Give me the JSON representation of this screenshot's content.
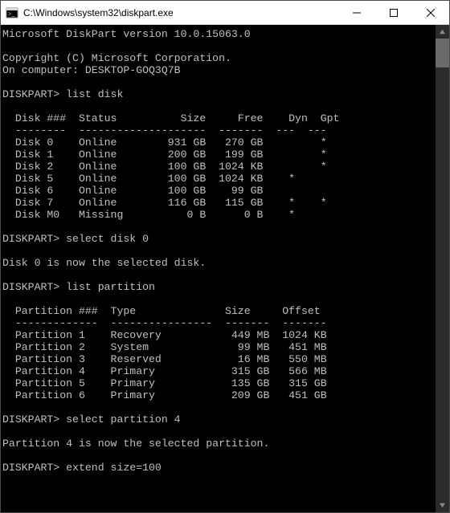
{
  "window": {
    "title": "C:\\Windows\\system32\\diskpart.exe"
  },
  "banner": {
    "version_line": "Microsoft DiskPart version 10.0.15063.0",
    "copyright": "Copyright (C) Microsoft Corporation.",
    "computer": "On computer: DESKTOP-GOQ3Q7B"
  },
  "prompt": "DISKPART>",
  "commands": {
    "list_disk": "list disk",
    "select_disk0": "select disk 0",
    "list_partition": "list partition",
    "select_part4": "select partition 4",
    "extend100": "extend size=100"
  },
  "messages": {
    "disk0_selected": "Disk 0 is now the selected disk.",
    "part4_selected": "Partition 4 is now the selected partition."
  },
  "disk_headers": {
    "disk": "Disk ###",
    "status": "Status",
    "size": "Size",
    "free": "Free",
    "dyn": "Dyn",
    "gpt": "Gpt"
  },
  "disks": [
    {
      "name": "Disk 0",
      "status": "Online",
      "size": "931 GB",
      "free": "270 GB",
      "dyn": "",
      "gpt": "*"
    },
    {
      "name": "Disk 1",
      "status": "Online",
      "size": "200 GB",
      "free": "199 GB",
      "dyn": "",
      "gpt": "*"
    },
    {
      "name": "Disk 2",
      "status": "Online",
      "size": "100 GB",
      "free": "1024 KB",
      "dyn": "",
      "gpt": "*"
    },
    {
      "name": "Disk 5",
      "status": "Online",
      "size": "100 GB",
      "free": "1024 KB",
      "dyn": "*",
      "gpt": ""
    },
    {
      "name": "Disk 6",
      "status": "Online",
      "size": "100 GB",
      "free": "99 GB",
      "dyn": "",
      "gpt": ""
    },
    {
      "name": "Disk 7",
      "status": "Online",
      "size": "116 GB",
      "free": "115 GB",
      "dyn": "*",
      "gpt": "*"
    },
    {
      "name": "Disk M0",
      "status": "Missing",
      "size": "0 B",
      "free": "0 B",
      "dyn": "*",
      "gpt": ""
    }
  ],
  "part_headers": {
    "part": "Partition ###",
    "type": "Type",
    "size": "Size",
    "offset": "Offset"
  },
  "partitions": [
    {
      "name": "Partition 1",
      "type": "Recovery",
      "size": "449 MB",
      "offset": "1024 KB"
    },
    {
      "name": "Partition 2",
      "type": "System",
      "size": "99 MB",
      "offset": "451 MB"
    },
    {
      "name": "Partition 3",
      "type": "Reserved",
      "size": "16 MB",
      "offset": "550 MB"
    },
    {
      "name": "Partition 4",
      "type": "Primary",
      "size": "315 GB",
      "offset": "566 MB"
    },
    {
      "name": "Partition 5",
      "type": "Primary",
      "size": "135 GB",
      "offset": "315 GB"
    },
    {
      "name": "Partition 6",
      "type": "Primary",
      "size": "209 GB",
      "offset": "451 GB"
    }
  ]
}
